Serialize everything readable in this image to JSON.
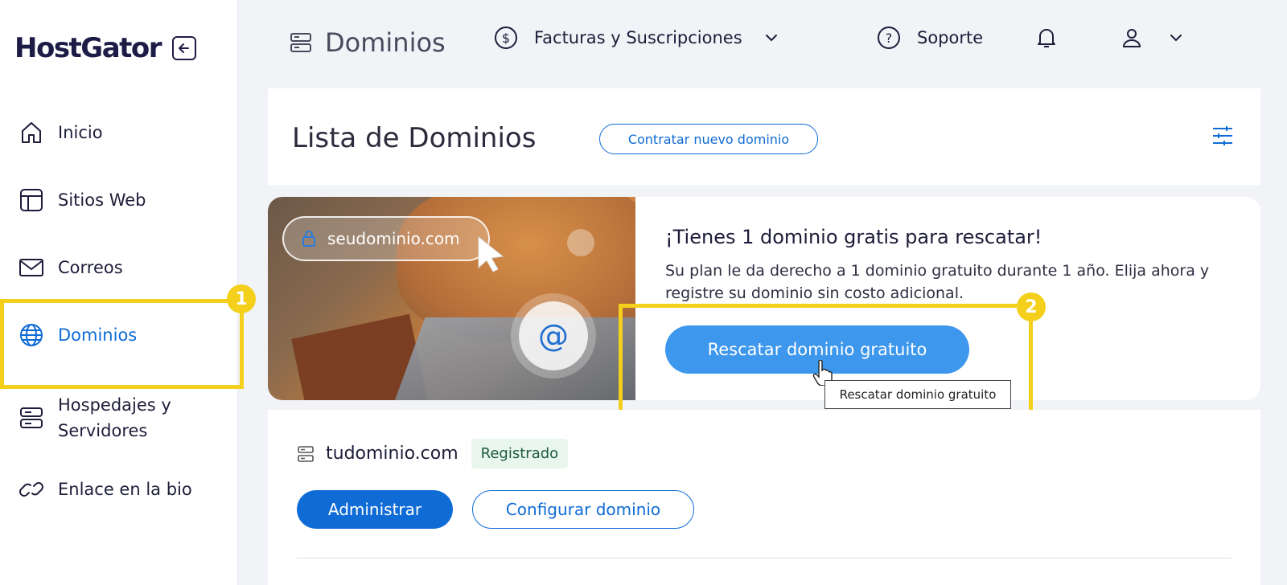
{
  "sidebar": {
    "logo": "HostGator",
    "items": [
      {
        "label": "Inicio",
        "icon": "home-icon"
      },
      {
        "label": "Sitios Web",
        "icon": "layout-icon"
      },
      {
        "label": "Correos",
        "icon": "mail-icon"
      },
      {
        "label": "Dominios",
        "icon": "globe-icon",
        "active": true
      },
      {
        "label": "Hospedajes y",
        "label2": "Servidores",
        "icon": "server-icon"
      },
      {
        "label": "Enlace en la bio",
        "icon": "link-icon"
      }
    ]
  },
  "topbar": {
    "title": "Dominios",
    "billing": "Facturas y Suscripciones",
    "support": "Soporte"
  },
  "list": {
    "title": "Lista de Dominios",
    "new_domain_button": "Contratar nuevo dominio"
  },
  "promo": {
    "url_text": "seudominio.com",
    "at_symbol": "@",
    "title": "¡Tienes 1 dominio gratis para rescatar!",
    "text": "Su plan le da derecho a 1 dominio gratuito durante 1 año. Elija ahora y registre su dominio sin costo adicional.",
    "button": "Rescatar dominio gratuito",
    "tooltip": "Rescatar dominio gratuito"
  },
  "domain": {
    "name": "tudominio.com",
    "status": "Registrado",
    "manage_button": "Administrar",
    "configure_button": "Configurar dominio"
  },
  "annotations": {
    "badge1": "1",
    "badge2": "2"
  },
  "colors": {
    "accent": "#0f6bd6",
    "primary_button": "#3d97ec",
    "highlight": "#f4d01c",
    "status_bg": "#e8f6ee"
  }
}
